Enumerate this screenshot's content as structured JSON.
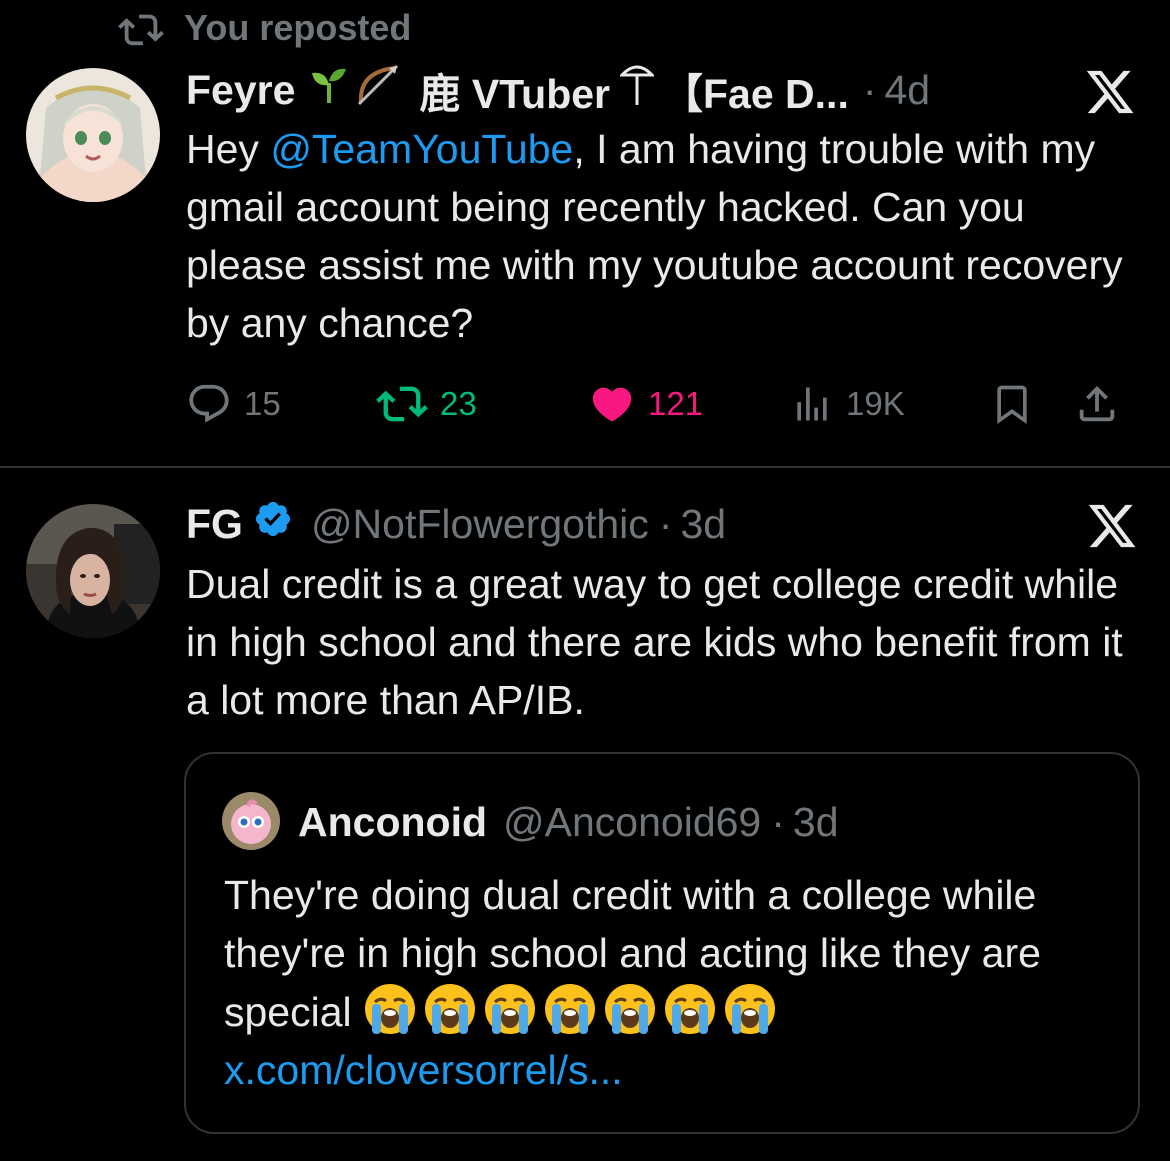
{
  "repost_indicator": {
    "label": "You reposted",
    "icon": "repost-icon"
  },
  "post1": {
    "author_name": "Feyre",
    "author_name_rest": "鹿 VTuber",
    "author_name_tail": "【Fae D...",
    "separator": "·",
    "time": "4d",
    "text_prefix": "Hey ",
    "mention": "@TeamYouTube",
    "text_suffix": ", I am having trouble with my gmail account being recently hacked. Can you please assist me with my youtube account recovery by any chance?",
    "stats": {
      "replies": "15",
      "reposts": "23",
      "likes": "121",
      "views": "19K"
    },
    "icons": [
      "seedling-icon",
      "bow-arrow-icon",
      "umbrella-icon",
      "x-logo-icon"
    ]
  },
  "post2": {
    "author_name": "FG",
    "verified": true,
    "handle": "@NotFlowergothic",
    "separator": "·",
    "time": "3d",
    "text": "Dual credit is a great way to get college credit while in high school and there are kids who benefit from it a lot more than AP/IB."
  },
  "quote": {
    "author_name": "Anconoid",
    "handle": "@Anconoid69",
    "separator": "·",
    "time": "3d",
    "text": "They're doing dual credit with a college while they're in high school and acting like they are special",
    "emoji_name": "loudly-crying-face-emoji",
    "emoji_count": 7,
    "link": "x.com/cloversorrel/s..."
  },
  "colors": {
    "background": "#000000",
    "text": "#e7e9ea",
    "muted": "#71767b",
    "link": "#1d9bf0",
    "repost_active": "#00ba7c",
    "like_active": "#f91880",
    "divider": "#2f3336"
  }
}
